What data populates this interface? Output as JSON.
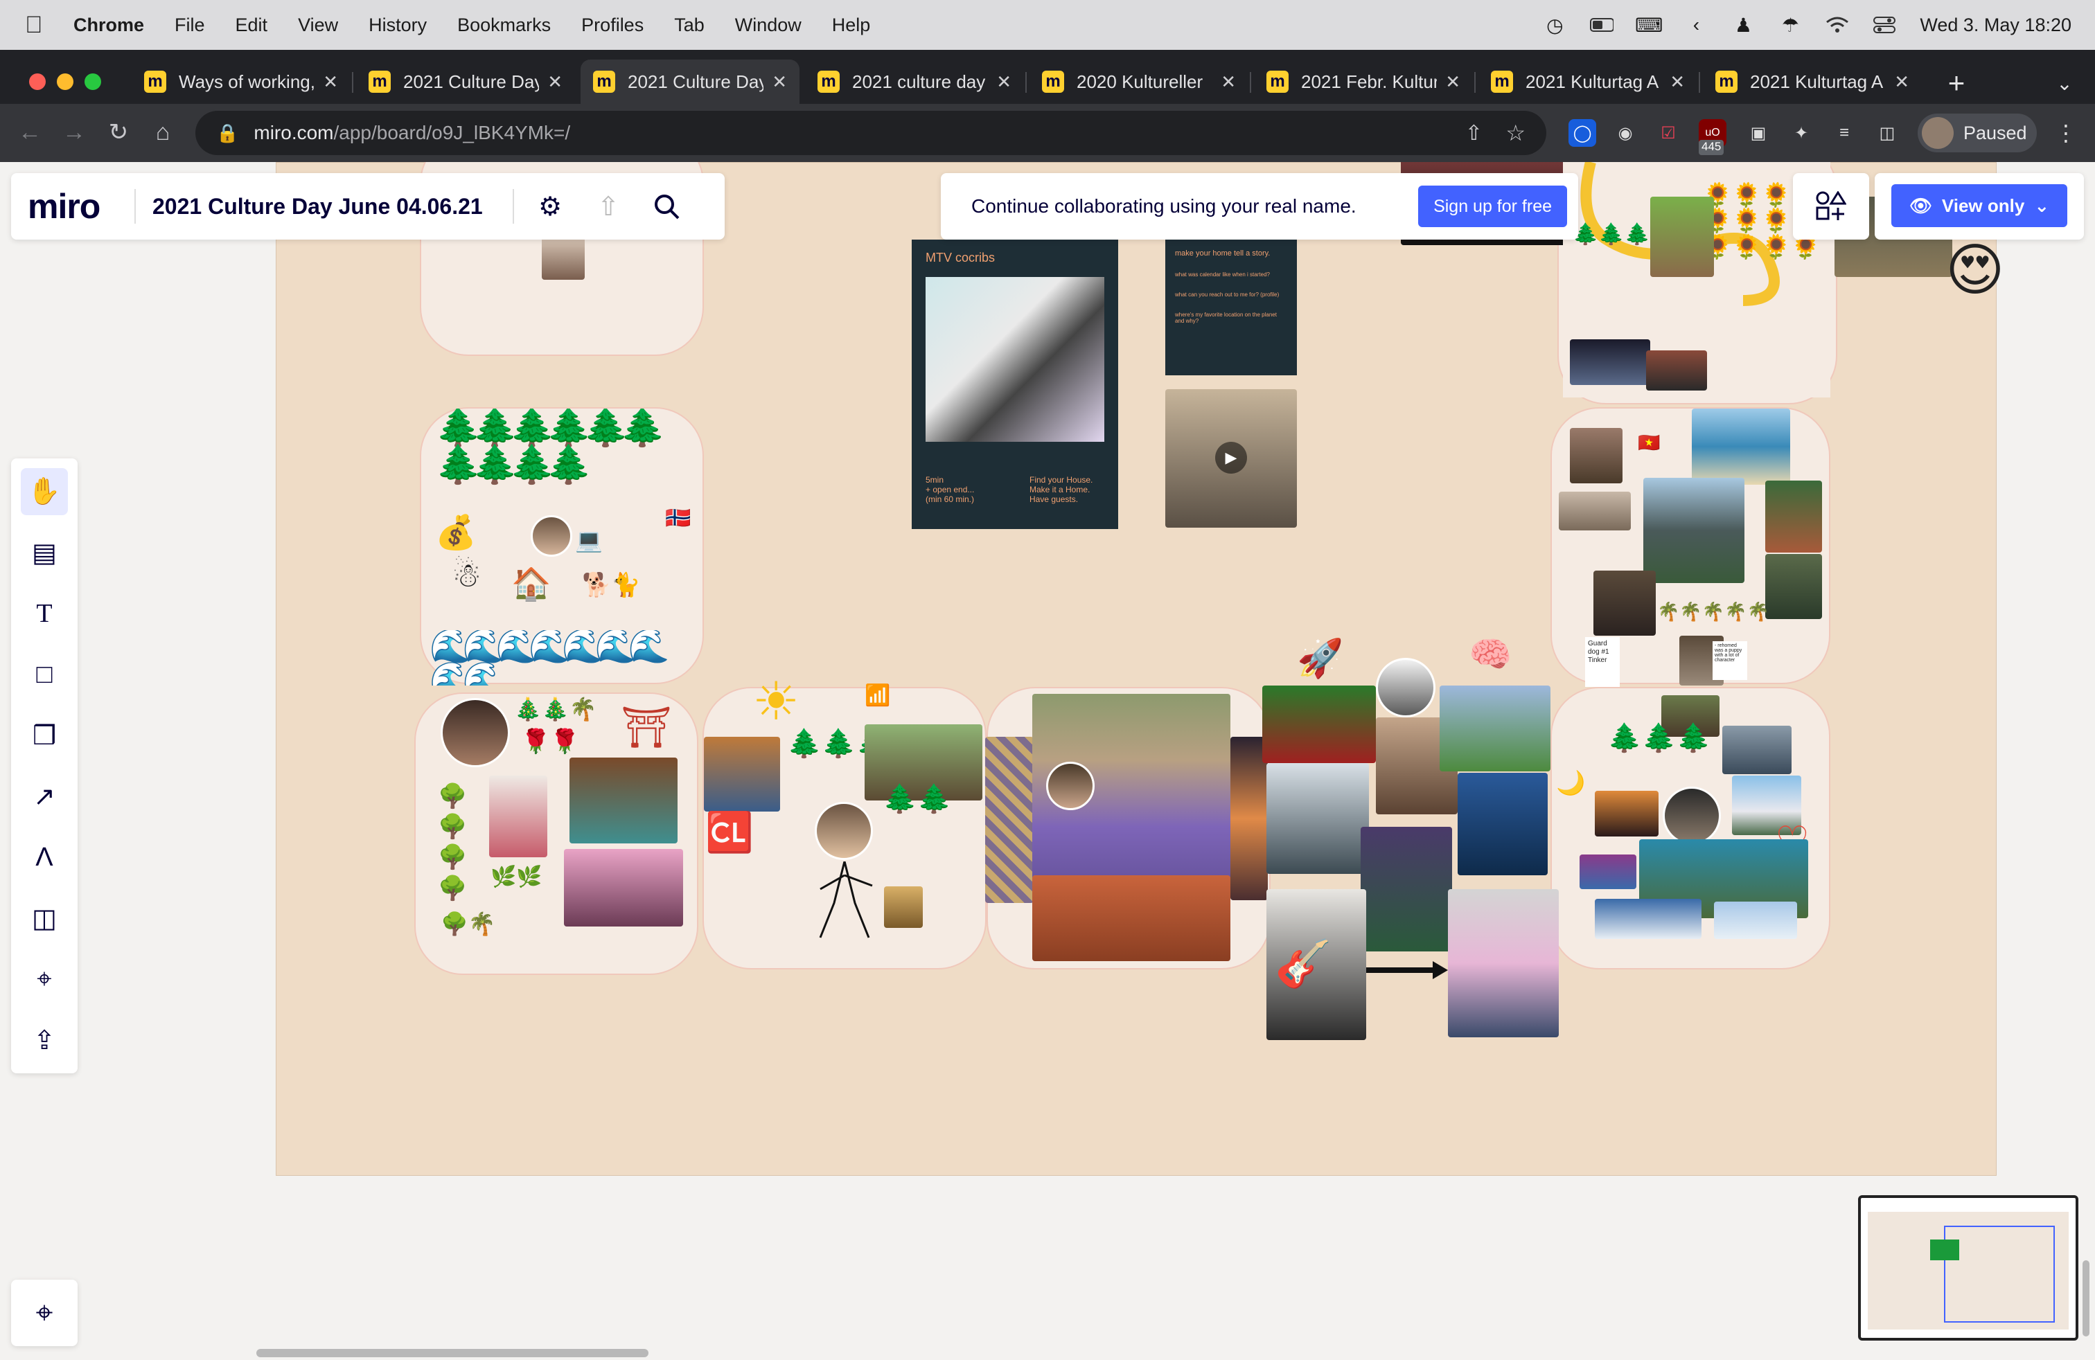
{
  "menubar": {
    "app": "Chrome",
    "items": [
      "File",
      "Edit",
      "View",
      "History",
      "Bookmarks",
      "Profiles",
      "Tab",
      "Window",
      "Help"
    ],
    "datetime": "Wed 3. May  18:20"
  },
  "tabs": [
    {
      "title": "Ways of working,",
      "active": false
    },
    {
      "title": "2021 Culture Day",
      "active": false
    },
    {
      "title": "2021 Culture Day",
      "active": true
    },
    {
      "title": "2021 culture day",
      "active": false
    },
    {
      "title": "2020 Kultureller",
      "active": false
    },
    {
      "title": "2021 Febr. Kultur",
      "active": false
    },
    {
      "title": "2021 Kulturtag A",
      "active": false
    },
    {
      "title": "2021 Kulturtag A",
      "active": false
    }
  ],
  "address": {
    "domain": "miro.com",
    "path": "/app/board/o9J_lBK4YMk=/"
  },
  "extensions": {
    "badge": "445"
  },
  "profile": {
    "label": "Paused"
  },
  "miro": {
    "logo": "miro",
    "board_title": "2021 Culture Day June 04.06.21",
    "banner_text": "Continue collaborating using your real name.",
    "signup_label": "Sign up for free",
    "view_only_label": "View only"
  },
  "board": {
    "mtv_card": {
      "title": "MTV cocribs",
      "left_text": "5min\n+ open end...\n(min 60 min.)",
      "right_text": "Find your House.\nMake it a Home.\nHave guests."
    },
    "story_card": {
      "title": "make your home tell a story.",
      "q1": "what was calendar like when i started?",
      "q2": "what can you reach out to me for? (profile)",
      "q3": "where's my favorite location on the planet and why?"
    },
    "notes": {
      "guard_dog": "Guard dog #1 Tinker",
      "puppy": "- rehomed was a puppy with a lot of character"
    }
  },
  "colors": {
    "board_bg": "#efdcc6",
    "cloud_fill": "#f5ebe3",
    "cloud_border": "#f0c8bb",
    "miro_blue": "#4262ff",
    "miro_navy": "#050038",
    "miro_yellow": "#ffd02f"
  }
}
